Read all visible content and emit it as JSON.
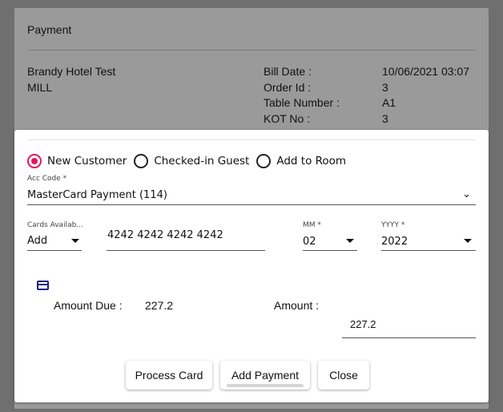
{
  "background": {
    "title": "Payment",
    "hotel_name": "Brandy Hotel Test",
    "hotel_sub": "MILL",
    "bill_date_label": "Bill Date :",
    "bill_date_value": "10/06/2021 03:07",
    "order_id_label": "Order Id :",
    "order_id_value": "3",
    "table_number_label": "Table Number :",
    "table_number_value": "A1",
    "kot_no_label": "KOT No :",
    "kot_no_value": "3"
  },
  "dialog": {
    "customer_options": [
      {
        "label": "New Customer",
        "selected": true
      },
      {
        "label": "Checked-in Guest",
        "selected": false
      },
      {
        "label": "Add to Room",
        "selected": false
      }
    ],
    "acc_code_label": "Acc Code *",
    "acc_code_value": "MasterCard Payment  (114)",
    "cards_available_label": "Cards Availab...",
    "cards_available_value": "Add",
    "card_number_value": "4242 4242 4242 4242",
    "mm_label": "MM *",
    "mm_value": "02",
    "yyyy_label": "YYYY *",
    "yyyy_value": "2022",
    "amount_due_label": "Amount Due :",
    "amount_due_value": "227.2",
    "amount_label": "Amount :",
    "amount_value": "227.2",
    "buttons": {
      "process_card": "Process Card",
      "add_payment": "Add Payment",
      "close": "Close"
    }
  },
  "colors": {
    "accent": "#e0185a",
    "card_icon": "#1a237e"
  },
  "icons": [
    "credit-card-icon",
    "caret-down-icon",
    "chevron-down-icon"
  ]
}
